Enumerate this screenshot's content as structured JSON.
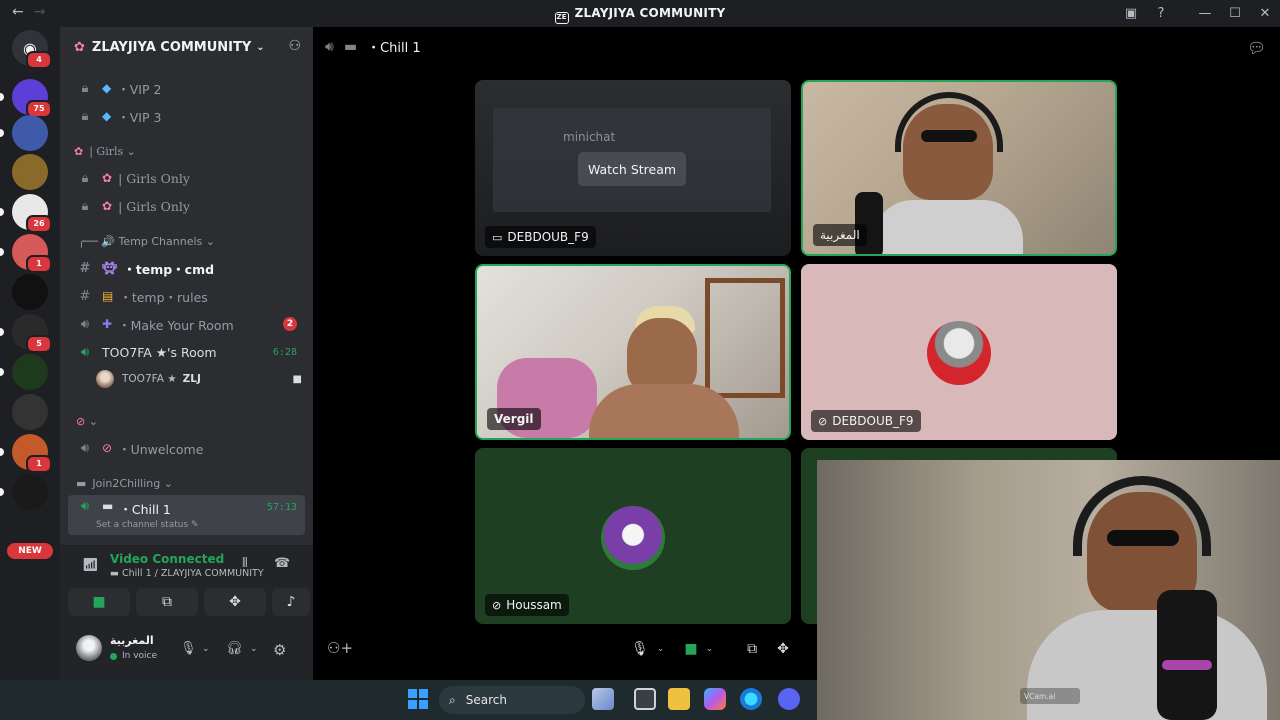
{
  "window": {
    "title": "ZLAYJIYA COMMUNITY",
    "logo_text": "ZE"
  },
  "rail": {
    "home_badge": "4",
    "servers": [
      {
        "name": "server-1",
        "badge": "75",
        "color": "#5b3fd6"
      },
      {
        "name": "server-2",
        "badge": "",
        "color": "#3f5aa8"
      },
      {
        "name": "server-3",
        "badge": "",
        "color": "#8a6a2a"
      },
      {
        "name": "server-4",
        "badge": "26",
        "color": "#e8e8e8"
      },
      {
        "name": "server-5",
        "badge": "1",
        "color": "#d65a5a"
      },
      {
        "name": "server-6",
        "badge": "",
        "color": "#111111"
      },
      {
        "name": "server-7",
        "badge": "5",
        "color": "#2a2a2a"
      },
      {
        "name": "server-8",
        "badge": "",
        "color": "#1d3a1d"
      },
      {
        "name": "server-9",
        "badge": "",
        "color": "#333333"
      },
      {
        "name": "server-10",
        "badge": "1",
        "color": "#c45a2a"
      },
      {
        "name": "server-11",
        "badge": "",
        "color": "#1a1a1a"
      }
    ],
    "new_label": "NEW"
  },
  "sidebar": {
    "server_name": "ZLAYJIYA COMMUNITY",
    "channels": {
      "vip2": "・VIP 2",
      "vip3": "・VIP 3",
      "girls_category": "| Girls",
      "girls1": "| Girls Only",
      "girls2": "| Girls Only",
      "temp_category": "╭── 🔊 Temp Channels",
      "temp_cmd": "・temp・cmd",
      "temp_rules": "・temp・rules",
      "make_room": "・Make Your Room",
      "make_room_badge": "2",
      "toofa_room": "TOO7FA ★'s Room",
      "toofa_timer": "6:28",
      "member_name": "TOO7FA ★",
      "member_tag": "ZLJ",
      "unwelcome": "・Unwelcome",
      "join_category": "Join2Chilling",
      "chill": "・Chill 1",
      "chill_timer": "57:13",
      "chill_status": "Set a channel status"
    }
  },
  "voice": {
    "title": "Video Connected",
    "subtitle": "Chill 1 / ZLAYJIYA COMMUNITY"
  },
  "user": {
    "name": "المغربية",
    "status": "In voice"
  },
  "main": {
    "channel_name": "・Chill 1",
    "tiles": {
      "stream_label": "DEBDOUB_F9",
      "watch_stream": "Watch Stream",
      "stream_bg_text": "minichat",
      "cam1_label": "المغربية",
      "cam2_label": "Vergil",
      "muted_label": "DEBDOUB_F9",
      "houssam_label": "Houssam"
    }
  },
  "webcam": {
    "watermark": "VCam.ai"
  },
  "taskbar": {
    "search_label": "Search"
  }
}
